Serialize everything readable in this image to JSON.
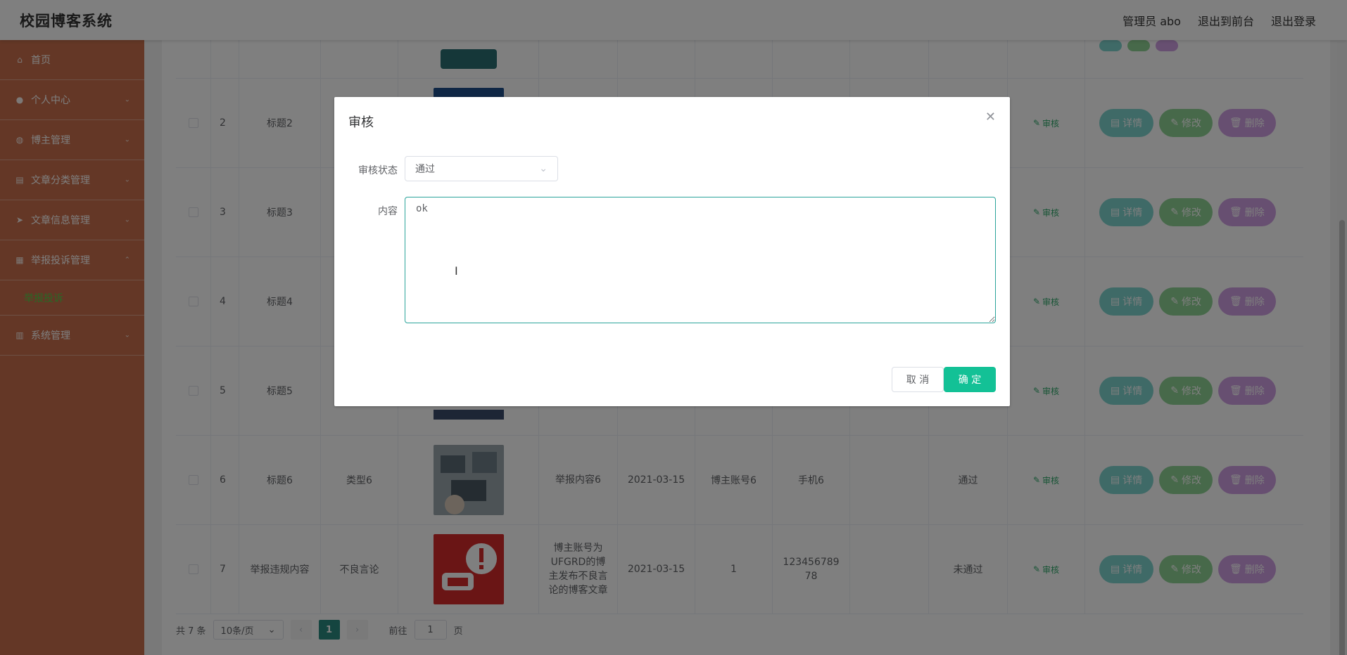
{
  "header": {
    "brand": "校园博客系统",
    "links": [
      "管理员 abo",
      "退出到前台",
      "退出登录"
    ]
  },
  "sidebar": {
    "items": [
      {
        "label": "首页",
        "icon": "home-icon",
        "has_arrow": false
      },
      {
        "label": "个人中心",
        "icon": "user-icon",
        "has_arrow": true
      },
      {
        "label": "博主管理",
        "icon": "globe-icon",
        "has_arrow": true
      },
      {
        "label": "文章分类管理",
        "icon": "folder-icon",
        "has_arrow": true
      },
      {
        "label": "文章信息管理",
        "icon": "send-icon",
        "has_arrow": true
      },
      {
        "label": "举报投诉管理",
        "icon": "grid-icon",
        "has_arrow": true
      }
    ],
    "submenu": "举报投诉",
    "last_item": {
      "label": "系统管理",
      "icon": "building-icon"
    }
  },
  "table": {
    "audit_label": "审核",
    "ops": {
      "detail": "详情",
      "edit": "修改",
      "delete": "删除"
    },
    "rows": [
      {
        "no": "",
        "title": "",
        "type": "",
        "content": "",
        "date": "",
        "account": "",
        "phone": "",
        "status": "",
        "thumb_color": "#2b6f73"
      },
      {
        "no": "2",
        "title": "标题2",
        "type": "",
        "content": "",
        "date": "",
        "account": "",
        "phone": "",
        "status": "",
        "thumb_color": "#1f4f8a"
      },
      {
        "no": "3",
        "title": "标题3",
        "type": "",
        "content": "",
        "date": "",
        "account": "",
        "phone": "",
        "status": "",
        "thumb_color": ""
      },
      {
        "no": "4",
        "title": "标题4",
        "type": "",
        "content": "",
        "date": "",
        "account": "",
        "phone": "",
        "status": "",
        "thumb_color": ""
      },
      {
        "no": "5",
        "title": "标题5",
        "type": "",
        "content": "",
        "date": "",
        "account": "",
        "phone": "",
        "status": "",
        "thumb_color": "#3a4a6a"
      },
      {
        "no": "6",
        "title": "标题6",
        "type": "类型6",
        "content": "举报内容6",
        "date": "2021-03-15",
        "account": "博主账号6",
        "phone": "手机6",
        "status": "通过",
        "thumb_color": "#7e8c93"
      },
      {
        "no": "7",
        "title": "举报违规内容",
        "type": "不良言论",
        "content": "博主账号为UFGRD的博主发布不良言论的博客文章",
        "date": "2021-03-15",
        "account": "1",
        "phone": "12345678978",
        "status": "未通过",
        "thumb_color": "#d42b2b"
      }
    ]
  },
  "pagination": {
    "total": "共 7 条",
    "page_size": "10条/页",
    "current_page": "1",
    "goto_label": "前往",
    "goto_value": "1",
    "page_suffix": "页"
  },
  "dialog": {
    "title": "审核",
    "status_label": "审核状态",
    "status_value": "通过",
    "content_label": "内容",
    "content_value": "ok",
    "cancel": "取 消",
    "ok": "确 定"
  },
  "colors": {
    "sidebar_bg": "#c86f4c",
    "primary": "#13c196",
    "submenu_active": "#52d04a"
  }
}
